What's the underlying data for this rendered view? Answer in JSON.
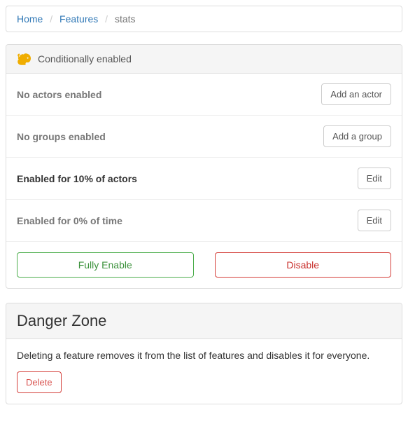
{
  "breadcrumb": {
    "home": "Home",
    "features": "Features",
    "current": "stats"
  },
  "status": {
    "label": "Conditionally enabled",
    "color": "#f0ad00"
  },
  "sections": {
    "actors": {
      "label": "No actors enabled",
      "button": "Add an actor"
    },
    "groups": {
      "label": "No groups enabled",
      "button": "Add a group"
    },
    "percent_actors": {
      "label": "Enabled for 10% of actors",
      "button": "Edit",
      "value": 10
    },
    "percent_time": {
      "label": "Enabled for 0% of time",
      "button": "Edit",
      "value": 0
    }
  },
  "actions": {
    "enable": "Fully Enable",
    "disable": "Disable"
  },
  "danger": {
    "title": "Danger Zone",
    "description": "Deleting a feature removes it from the list of features and disables it for everyone.",
    "delete": "Delete"
  }
}
